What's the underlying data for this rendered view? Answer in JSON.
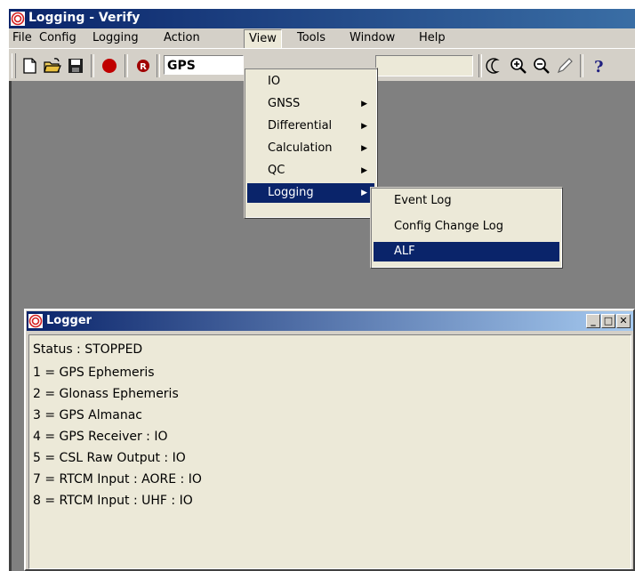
{
  "window": {
    "title": "Logging - Verify"
  },
  "menubar": [
    "File",
    "Config",
    "Logging",
    "Action",
    "View",
    "Tools",
    "Window",
    "Help"
  ],
  "toolbar": {
    "station_combo_value": "GPS"
  },
  "view_menu": {
    "items": [
      {
        "label": "IO",
        "submenu": false
      },
      {
        "label": "GNSS",
        "submenu": true
      },
      {
        "label": "Differential",
        "submenu": true
      },
      {
        "label": "Calculation",
        "submenu": true
      },
      {
        "label": "QC",
        "submenu": true
      },
      {
        "label": "Logging",
        "submenu": true,
        "highlighted": true
      }
    ]
  },
  "logging_submenu": {
    "items": [
      {
        "label": "Event Log"
      },
      {
        "label": "Config Change Log"
      },
      {
        "label": "ALF",
        "highlighted": true
      }
    ]
  },
  "logger": {
    "title": "Logger",
    "lines": [
      "Status : STOPPED",
      "1 = GPS Ephemeris",
      "2 = Glonass Ephemeris",
      "3 = GPS Almanac",
      "4 = GPS Receiver : IO",
      "5 = CSL Raw Output : IO",
      "7 = RTCM Input : AORE : IO",
      "8 = RTCM Input : UHF : IO"
    ]
  },
  "colors": {
    "title_active": "#0a246a",
    "menu_highlight": "#0a246a",
    "face": "#d4d0c8",
    "client": "#808080"
  }
}
